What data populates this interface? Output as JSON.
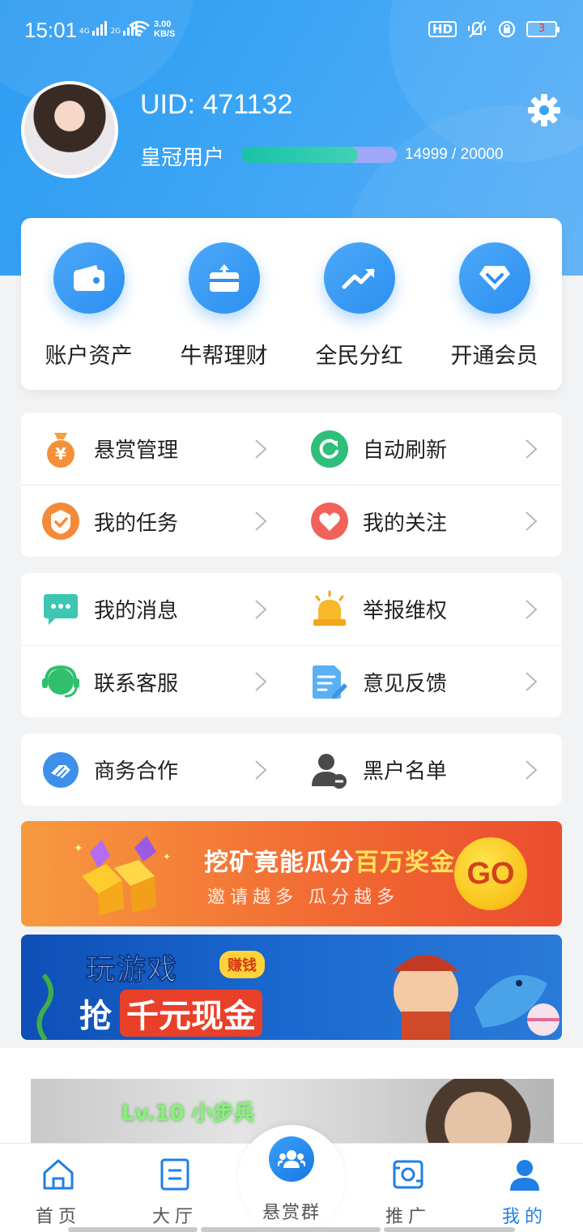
{
  "status_bar": {
    "time": "15:01",
    "net1": "4G",
    "net2": "2G",
    "speed_value": "3.00",
    "speed_unit": "KB/S",
    "hd": "HD",
    "battery": "3"
  },
  "profile": {
    "uid": "UID: 471132",
    "rank": "皇冠用户",
    "progress_current": 14999,
    "progress_max": 20000,
    "progress_text": "14999 / 20000"
  },
  "quick_actions": [
    {
      "label": "账户资产",
      "icon": "wallet-icon"
    },
    {
      "label": "牛帮理财",
      "icon": "finance-upload-icon"
    },
    {
      "label": "全民分红",
      "icon": "trend-up-icon"
    },
    {
      "label": "开通会员",
      "icon": "diamond-icon"
    }
  ],
  "menu_groups": [
    [
      [
        {
          "label": "悬赏管理",
          "icon": "money-bag-icon"
        },
        {
          "label": "自动刷新",
          "icon": "refresh-icon"
        }
      ],
      [
        {
          "label": "我的任务",
          "icon": "task-shield-icon"
        },
        {
          "label": "我的关注",
          "icon": "heart-icon"
        }
      ]
    ],
    [
      [
        {
          "label": "我的消息",
          "icon": "message-icon"
        },
        {
          "label": "举报维权",
          "icon": "alarm-light-icon"
        }
      ],
      [
        {
          "label": "联系客服",
          "icon": "headset-icon"
        },
        {
          "label": "意见反馈",
          "icon": "feedback-edit-icon"
        }
      ]
    ],
    [
      [
        {
          "label": "商务合作",
          "icon": "handshake-icon"
        },
        {
          "label": "黑户名单",
          "icon": "user-blacklist-icon"
        }
      ]
    ]
  ],
  "banners": {
    "mining": {
      "title_a": "挖矿竟能瓜分",
      "title_b": "百万奖金",
      "subtitle": "邀请越多 瓜分越多",
      "go": "GO"
    },
    "game": {
      "line1": "玩游戏",
      "tag": "赚钱",
      "line2_a": "抢",
      "line2_b": "千元现金"
    }
  },
  "preview": {
    "level_label": "Lv.10 小步兵"
  },
  "tab_bar": {
    "tabs": [
      {
        "label": "首页",
        "icon": "home-icon",
        "active": false
      },
      {
        "label": "大厅",
        "icon": "hall-list-icon",
        "active": false
      },
      {
        "label": "悬赏群",
        "icon": "group-icon",
        "active": false
      },
      {
        "label": "推广",
        "icon": "promote-icon",
        "active": false
      },
      {
        "label": "我的",
        "icon": "user-icon",
        "active": true
      }
    ]
  },
  "colors": {
    "primary": "#2e9cf2",
    "active_tab": "#1f7fe6",
    "progress_fill": "#17c2a6",
    "progress_track": "#9ea8f6"
  }
}
